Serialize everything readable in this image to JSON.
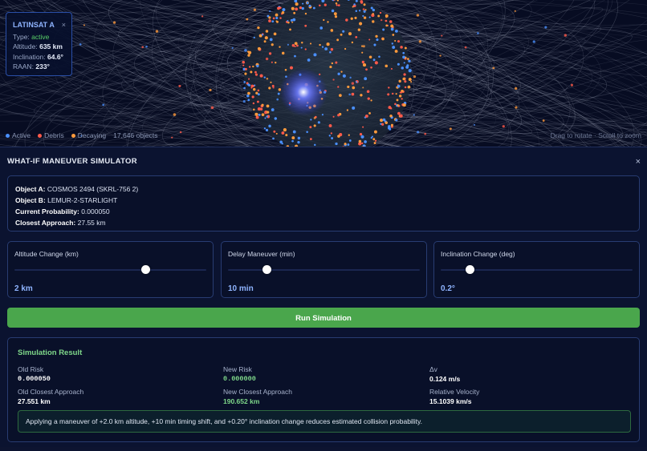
{
  "info_card": {
    "name": "LATINSAT A",
    "close": "×",
    "type_label": "Type:",
    "type_value": "active",
    "altitude_label": "Altitude:",
    "altitude_value": "635 km",
    "inclination_label": "Inclination:",
    "inclination_value": "64.6°",
    "raan_label": "RAAN:",
    "raan_value": "233°"
  },
  "legend": {
    "active": "Active",
    "debris": "Debris",
    "decaying": "Decaying",
    "count": "17,646 objects",
    "colors": {
      "active": "#4a90ff",
      "debris": "#ff5a4a",
      "decaying": "#ff9a3c"
    }
  },
  "hint": "Drag to rotate · Scroll to zoom",
  "panel": {
    "title": "WHAT-IF MANEUVER SIMULATOR",
    "close": "×"
  },
  "objects": {
    "a_label": "Object A:",
    "a_value": "COSMOS 2494 (SKRL-756 2)",
    "b_label": "Object B:",
    "b_value": "LEMUR-2-STARLIGHT",
    "prob_label": "Current Probability:",
    "prob_value": "0.000050",
    "approach_label": "Closest Approach:",
    "approach_value": "27.55 km"
  },
  "sliders": [
    {
      "label": "Altitude Change (km)",
      "value": "2 km",
      "fraction": 0.68
    },
    {
      "label": "Delay Maneuver (min)",
      "value": "10 min",
      "fraction": 0.2
    },
    {
      "label": "Inclination Change (deg)",
      "value": "0.2°",
      "fraction": 0.15
    }
  ],
  "run_button": "Run Simulation",
  "result": {
    "title": "Simulation Result",
    "old_risk_label": "Old Risk",
    "old_risk_value": "0.000050",
    "new_risk_label": "New Risk",
    "new_risk_value": "0.000000",
    "dv_label": "Δv",
    "dv_value": "0.124 m/s",
    "old_ca_label": "Old Closest Approach",
    "old_ca_value": "27.551 km",
    "new_ca_label": "New Closest Approach",
    "new_ca_value": "190.652 km",
    "rel_vel_label": "Relative Velocity",
    "rel_vel_value": "15.1039 km/s",
    "summary": "Applying a maneuver of +2.0 km altitude, +10 min timing shift, and +0.20° inclination change reduces estimated collision probability."
  }
}
